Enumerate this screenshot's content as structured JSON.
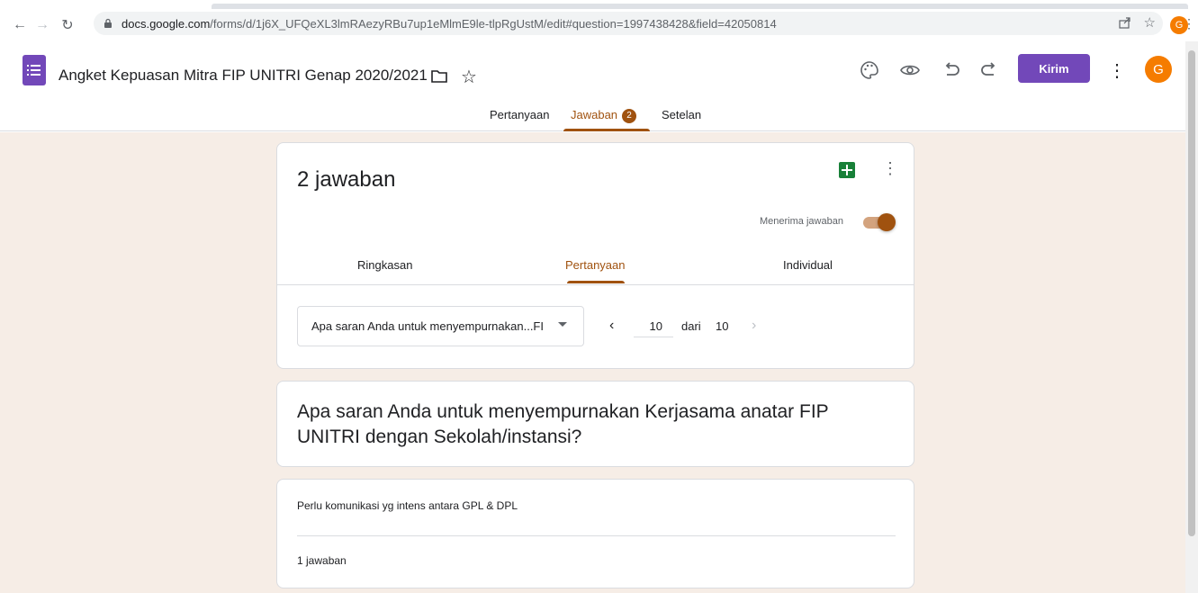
{
  "browser": {
    "url_host": "docs.google.com",
    "url_path": "/forms/d/1j6X_UFQeXL3lmRAezyRBu7up1eMlmE9le-tlpRgUstM/edit#question=1997438428&field=42050814",
    "profile_initial": "G"
  },
  "header": {
    "title": "Angket Kepuasan Mitra FIP UNITRI  Genap 2020/2021",
    "send_label": "Kirim",
    "avatar_initial": "G",
    "accent_color": "#7248b9"
  },
  "tabs": {
    "questions": "Pertanyaan",
    "responses": "Jawaban",
    "responses_badge": "2",
    "settings": "Setelan",
    "active_color": "#a0520f"
  },
  "summary": {
    "response_count": "2 jawaban",
    "accepting_label": "Menerima jawaban",
    "accepting": true,
    "subtabs": [
      "Ringkasan",
      "Pertanyaan",
      "Individual"
    ],
    "active_subtab": "Pertanyaan",
    "selected_question": "Apa saran Anda untuk menyempurnakan...FI",
    "pager_current": "10",
    "pager_of": "dari",
    "pager_total": "10"
  },
  "question": {
    "text": "Apa saran Anda untuk menyempurnakan Kerjasama anatar FIP UNITRI dengan Sekolah/instansi?"
  },
  "answer": {
    "text": "Perlu komunikasi yg intens antara GPL & DPL",
    "count_label": "1 jawaban"
  }
}
